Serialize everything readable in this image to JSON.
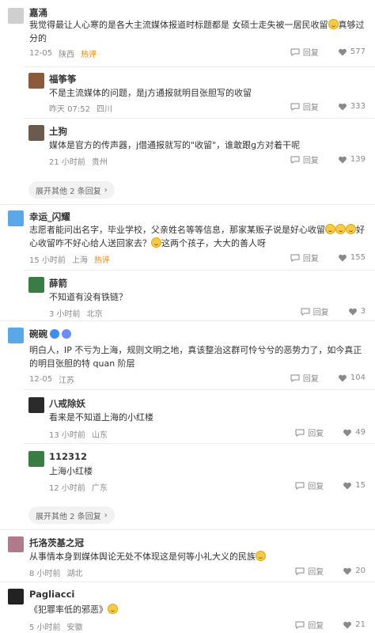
{
  "actions": {
    "reply_label": "回复"
  },
  "comments": [
    {
      "name": "嘉涌",
      "text1": "我觉得最让人心寒的是各大主流媒体报道时标题都是 女硕士走失被一居民收留",
      "text2": "真够过分的",
      "date": "12-05",
      "location": "陕西",
      "hot": "热评",
      "likes": "577",
      "avatar_color": "#c9c9c9"
    },
    {
      "name": "福筝筝",
      "text": "不是主流媒体的问题，是j方通报就明目张胆写的收留",
      "date": "昨天 07:52",
      "location": "四川",
      "likes": "333",
      "avatar_color": "#8a5a3a"
    },
    {
      "name": "土狗",
      "text": "媒体是官方的传声器，j借通报就写的\"收留\"，谁敢跟g方对着干呢",
      "date": "21 小时前",
      "location": "贵州",
      "likes": "139",
      "avatar_color": "#6b5a4e"
    },
    {
      "expand_label": "展开其他 2 条回复"
    },
    {
      "name": "幸运_闪耀",
      "text1": "志愿者能问出名字，毕业学校，父亲姓名等等信息，那家某贩子说是好心收留",
      "text2": "好心收留咋不好心给人送回家去？",
      "text3": "这两个孩子，大大的善人呀",
      "date": "15 小时前",
      "location": "上海",
      "hot": "热评",
      "likes": "155",
      "avatar_color": "#5aa8e6"
    },
    {
      "name": "薛箭",
      "text": "不知道有没有铁链？",
      "date": "3 小时前",
      "location": "北京",
      "likes": "3",
      "avatar_color": "#3a7d44"
    },
    {
      "name": "碗碗",
      "text": "明白人，IP 不亏为上海，规则文明之地，真该整治这群可怜兮兮的恶势力了，如今真正的明目张胆的特 quan 阶层",
      "date": "12-05",
      "location": "江苏",
      "likes": "104",
      "avatar_color": "#5aa8e6"
    },
    {
      "name": "八戒除妖",
      "text": "看来是不知道上海的小红楼",
      "date": "13 小时前",
      "location": "山东",
      "likes": "49",
      "avatar_color": "#2b2b2b"
    },
    {
      "name": "112312",
      "text": "上海小红楼",
      "date": "12 小时前",
      "location": "广东",
      "likes": "15",
      "avatar_color": "#3a7d44"
    },
    {
      "expand_label": "展开其他 2 条回复"
    },
    {
      "name": "托洛茨基之冠",
      "text": "从事情本身到媒体舆论无处不体现这是何等小礼大义的民族",
      "date": "8 小时前",
      "location": "湖北",
      "likes": "20",
      "avatar_color": "#b07a8a"
    },
    {
      "name": "Pagliacci",
      "text": "《犯罪率低的邪恶》",
      "date": "5 小时前",
      "location": "安徽",
      "likes": "21",
      "avatar_color": "#222222"
    }
  ],
  "colors": {
    "hot": "#ff8200",
    "meta": "#8a8a8a",
    "verified": "#3d8ef0"
  }
}
